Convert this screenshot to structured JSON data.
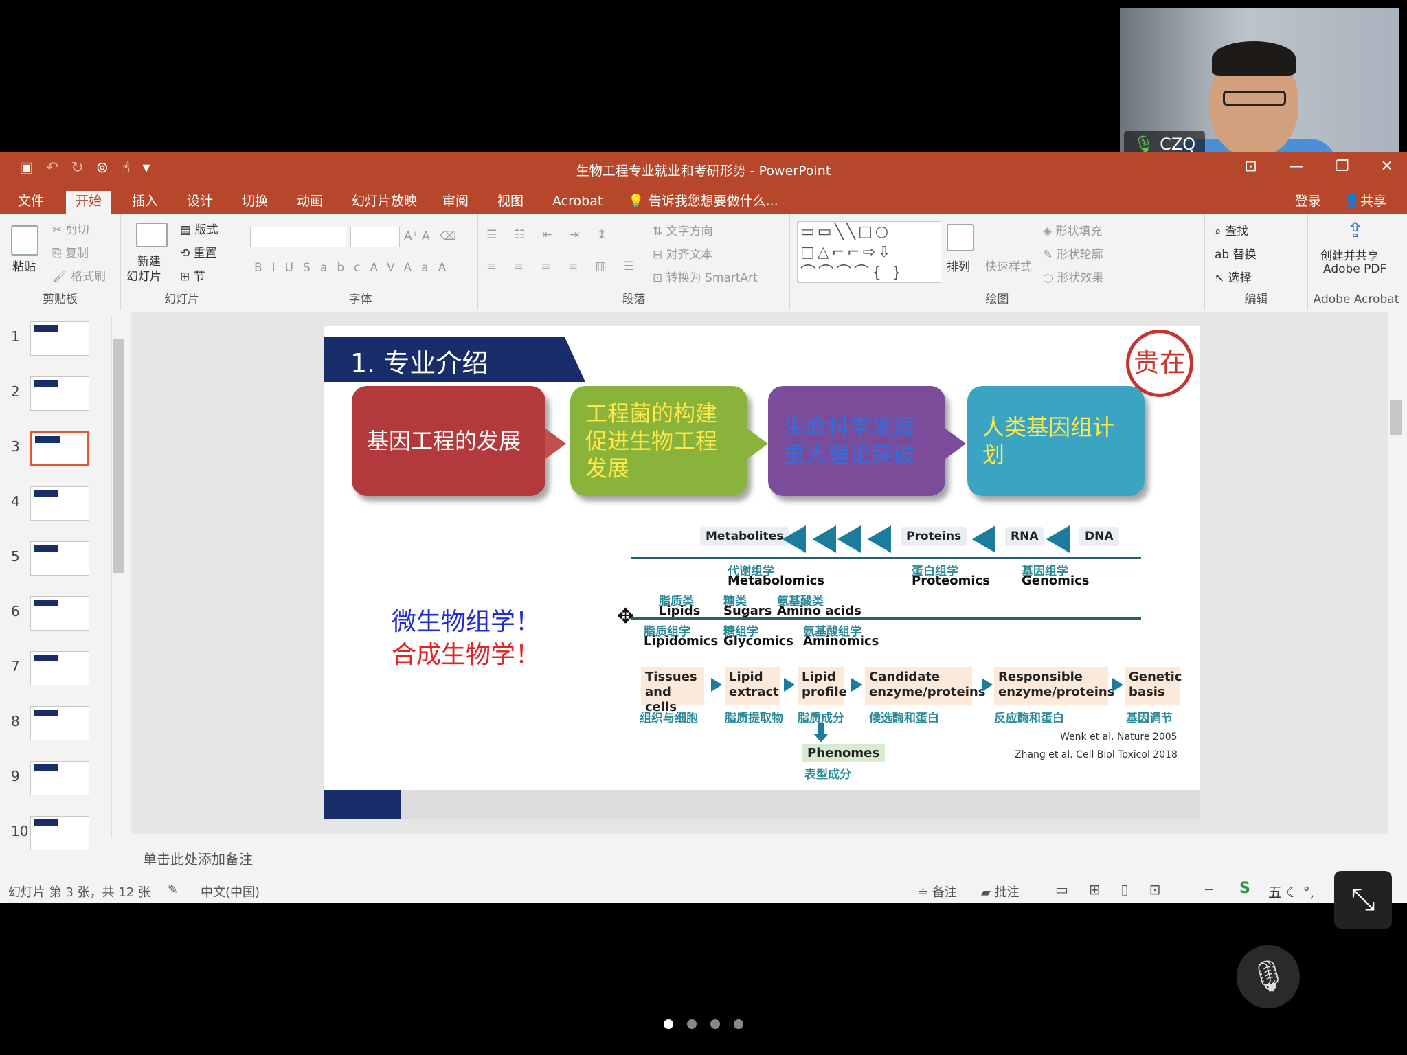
{
  "window": {
    "title": "生物工程专业就业和考研形势 - PowerPoint",
    "colors": {
      "accent": "#b7472a",
      "selected_thumb": "#e0573a"
    }
  },
  "tabs": [
    {
      "label": "文件",
      "active": false
    },
    {
      "label": "开始",
      "active": true
    },
    {
      "label": "插入",
      "active": false
    },
    {
      "label": "设计",
      "active": false
    },
    {
      "label": "切换",
      "active": false
    },
    {
      "label": "动画",
      "active": false
    },
    {
      "label": "幻灯片放映",
      "active": false
    },
    {
      "label": "审阅",
      "active": false
    },
    {
      "label": "视图",
      "active": false
    },
    {
      "label": "Acrobat",
      "active": false
    },
    {
      "label": "告诉我您想要做什么...",
      "active": false
    }
  ],
  "account": {
    "signin": "登录",
    "share": "共享"
  },
  "ribbon": {
    "clipboard": {
      "label": "剪贴板",
      "paste": "粘贴",
      "cut": "剪切",
      "copy": "复制",
      "format_painter": "格式刷"
    },
    "slides": {
      "label": "幻灯片",
      "new_slide_1": "新建",
      "new_slide_2": "幻灯片",
      "layout": "版式",
      "reset": "重置",
      "section": "节"
    },
    "font": {
      "label": "字体"
    },
    "paragraph": {
      "label": "段落",
      "text_direction": "文字方向",
      "align_text": "对齐文本",
      "smartart": "转换为 SmartArt"
    },
    "drawing": {
      "label": "绘图",
      "arrange": "排列",
      "quick_styles": "快速样式",
      "shape_fill": "形状填充",
      "shape_outline": "形状轮廓",
      "shape_effects": "形状效果"
    },
    "editing": {
      "label": "编辑",
      "find": "查找",
      "replace": "替换",
      "select": "选择"
    },
    "acrobat": {
      "label": "Adobe Acrobat",
      "create_1": "创建并共享",
      "create_2": "Adobe PDF"
    }
  },
  "thumbnails": [
    {
      "num": "1"
    },
    {
      "num": "2"
    },
    {
      "num": "3"
    },
    {
      "num": "4"
    },
    {
      "num": "5"
    },
    {
      "num": "6"
    },
    {
      "num": "7"
    },
    {
      "num": "8"
    },
    {
      "num": "9"
    },
    {
      "num": "10"
    }
  ],
  "selected_slide": "3",
  "slide": {
    "header": "1. 专业介绍",
    "logo_text": "贵在",
    "boxes": [
      {
        "text": "基因工程的发展",
        "bg": "#b33a3c",
        "color": "#ffffff"
      },
      {
        "text": "工程菌的构建促进生物工程发展",
        "bg": "#8ab33b",
        "color": "#ffe84a"
      },
      {
        "text": "生命科学发展重大理论突破",
        "bg": "#7a4c9a",
        "color": "#2f6fe0"
      },
      {
        "text": "人类基因组计划",
        "bg": "#3aa4c2",
        "color": "#ffe84a"
      }
    ],
    "microbio": "微生物组学！",
    "synbio": "合成生物学！"
  },
  "figure": {
    "top_row": [
      "Metabolites",
      "Proteins",
      "RNA",
      "DNA"
    ],
    "metabolomics_cn": "代谢组学",
    "metabolomics": "Metabolomics",
    "proteomics_cn": "蛋白组学",
    "proteomics": "Proteomics",
    "genomics_cn": "基因组学",
    "genomics": "Genomics",
    "lipids_cn": "脂质类",
    "lipids": "Lipids",
    "sugars_cn": "糖类",
    "sugars": "Sugars",
    "amino_cn": "氨基酸类",
    "amino": "Amino acids",
    "lipidomics_cn": "脂质组学",
    "lipidomics": "Lipidomics",
    "glycomics_cn": "糖组学",
    "glycomics": "Glycomics",
    "aminomics_cn": "氨基酸组学",
    "aminomics": "Aminomics",
    "flow": [
      {
        "l1": "Tissues",
        "l2": "and cells",
        "cn": "组织与细胞"
      },
      {
        "l1": "Lipid",
        "l2": "extract",
        "cn": "脂质提取物"
      },
      {
        "l1": "Lipid",
        "l2": "profile",
        "cn": "脂质成分"
      },
      {
        "l1": "Candidate",
        "l2": "enzyme/proteins",
        "cn": "候选酶和蛋白"
      },
      {
        "l1": "Responsible",
        "l2": "enzyme/proteins",
        "cn": "反应酶和蛋白"
      },
      {
        "l1": "Genetic",
        "l2": "basis",
        "cn": "基因调节"
      }
    ],
    "phenomes": "Phenomes",
    "phenomes_cn": "表型成分",
    "ref1": "Wenk et al.  Nature 2005",
    "ref2": "Zhang et al. Cell Biol Toxicol 2018"
  },
  "notes_placeholder": "单击此处添加备注",
  "status": {
    "slide_info": "幻灯片 第 3 张，共 12 张",
    "language": "中文(中国)",
    "notes": "备注",
    "comments": "批注"
  },
  "video": {
    "name": "CZQ"
  }
}
